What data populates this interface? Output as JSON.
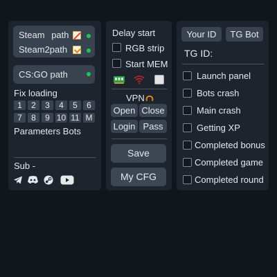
{
  "left": {
    "steam_path": {
      "label_a": "Steam",
      "label_b": "path"
    },
    "steam2_path": {
      "label": "Steam2path"
    },
    "csgo_path": {
      "label": "CS:GO path"
    },
    "fix_loading": {
      "label": "Fix loading"
    },
    "numbers_row1": [
      "1",
      "2",
      "3",
      "4",
      "5",
      "6"
    ],
    "numbers_row2": [
      "7",
      "8",
      "9",
      "10",
      "11",
      "M"
    ],
    "parameters_bots": {
      "label": "Parameters Bots"
    },
    "sub": {
      "label": "Sub -"
    },
    "socials": [
      "telegram-icon",
      "discord-icon",
      "steam-icon",
      "youtube-icon"
    ],
    "status_color": "#1fc453"
  },
  "middle": {
    "delay_start": {
      "label": "Delay start"
    },
    "rgb_strip": {
      "label": "RGB strip",
      "checked": false
    },
    "start_mem": {
      "label": "Start MEM",
      "checked": false
    },
    "vpn": {
      "label": "VPN"
    },
    "buttons": {
      "open": "Open",
      "close": "Close",
      "login": "Login",
      "pass": "Pass",
      "save": "Save",
      "my_cfg": "My CFG"
    }
  },
  "right": {
    "your_id": "Your ID",
    "tg_bot": "TG Bot",
    "tg_id": {
      "label": "TG ID:"
    },
    "options": [
      {
        "label": "Launch panel",
        "checked": false
      },
      {
        "label": "Bots crash",
        "checked": false
      },
      {
        "label": "Main crash",
        "checked": false
      },
      {
        "label": "Getting XP",
        "checked": false
      },
      {
        "label": "Completed bonus",
        "checked": false
      },
      {
        "label": "Completed game",
        "checked": false
      },
      {
        "label": "Completed round",
        "checked": false
      }
    ]
  }
}
